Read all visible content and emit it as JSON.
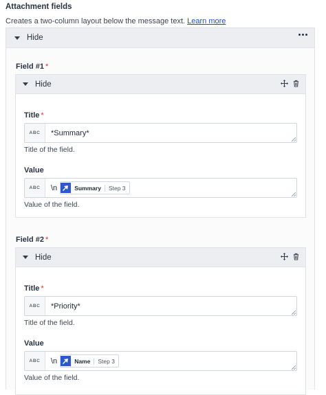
{
  "section": {
    "title": "Attachment fields",
    "description": "Creates a two-column layout below the message text.",
    "learn_more": "Learn more",
    "header_label": "Hide"
  },
  "fields": [
    {
      "label": "Field #1",
      "required_mark": "*",
      "header_label": "Hide",
      "title": {
        "label": "Title",
        "required_mark": "*",
        "badge": "ABC",
        "value": "*Summary*",
        "help": "Title of the field."
      },
      "value": {
        "label": "Value",
        "badge": "ABC",
        "prefix": "\\n",
        "pill_name": "Summary",
        "pill_step": "Step 3",
        "help": "Value of the field."
      }
    },
    {
      "label": "Field #2",
      "required_mark": "*",
      "header_label": "Hide",
      "title": {
        "label": "Title",
        "required_mark": "*",
        "badge": "ABC",
        "value": "*Priority*",
        "help": "Title of the field."
      },
      "value": {
        "label": "Value",
        "badge": "ABC",
        "prefix": "\\n",
        "pill_name": "Name",
        "pill_step": "Step 3",
        "help": "Value of the field."
      }
    }
  ],
  "colors": {
    "accent": "#2f57c9",
    "required": "#d93025",
    "link": "#1f4fbf"
  },
  "icons": [
    "caret-down-icon",
    "kebab-menu-icon",
    "move-icon",
    "trash-icon",
    "step-logo-icon"
  ]
}
